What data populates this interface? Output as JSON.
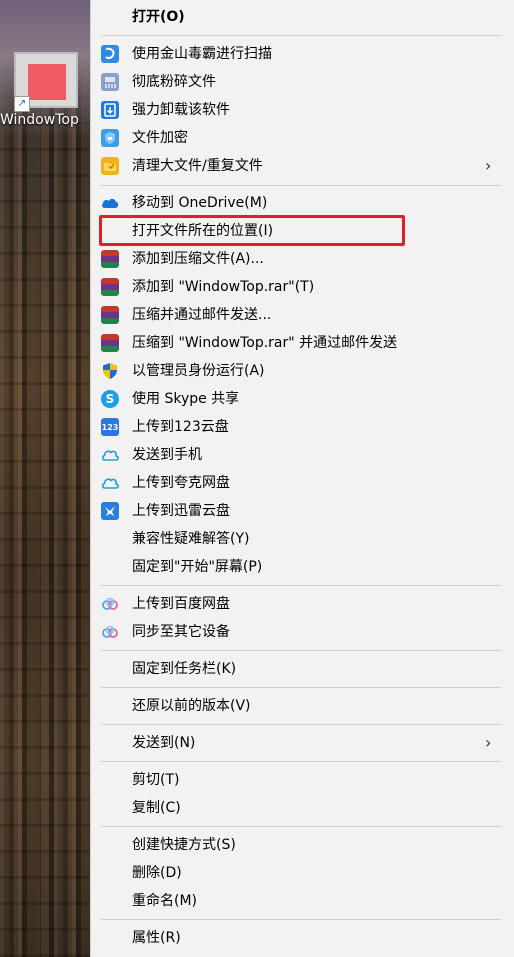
{
  "desktop": {
    "shortcut_label": "WindowTop"
  },
  "menu": {
    "items": [
      {
        "label": "打开(O)",
        "icon": "none",
        "bold": true
      },
      {
        "label": "使用金山毒霸进行扫描",
        "icon": "kingsoft-shield-icon"
      },
      {
        "label": "彻底粉碎文件",
        "icon": "shredder-icon"
      },
      {
        "label": "强力卸载该软件",
        "icon": "uninstall-icon"
      },
      {
        "label": "文件加密",
        "icon": "lock-shield-icon"
      },
      {
        "label": "清理大文件/重复文件",
        "icon": "folder-clean-icon"
      },
      {
        "label": "移动到 OneDrive(M)",
        "icon": "onedrive-cloud-icon"
      },
      {
        "label": "打开文件所在的位置(I)",
        "icon": "none"
      },
      {
        "label": "添加到压缩文件(A)...",
        "icon": "winrar-icon"
      },
      {
        "label": "添加到 \"WindowTop.rar\"(T)",
        "icon": "winrar-icon"
      },
      {
        "label": "压缩并通过邮件发送...",
        "icon": "winrar-icon"
      },
      {
        "label": "压缩到 \"WindowTop.rar\" 并通过邮件发送",
        "icon": "winrar-icon"
      },
      {
        "label": "以管理员身份运行(A)",
        "icon": "uac-shield-icon"
      },
      {
        "label": "使用 Skype 共享",
        "icon": "skype-icon"
      },
      {
        "label": "上传到123云盘",
        "icon": "cloud-123-icon"
      },
      {
        "label": "发送到手机",
        "icon": "cloud-phone-icon"
      },
      {
        "label": "上传到夸克网盘",
        "icon": "quark-cloud-icon"
      },
      {
        "label": "上传到迅雷云盘",
        "icon": "xunlei-bird-icon"
      },
      {
        "label": "兼容性疑难解答(Y)",
        "icon": "none"
      },
      {
        "label": "固定到\"开始\"屏幕(P)",
        "icon": "none"
      },
      {
        "label": "上传到百度网盘",
        "icon": "baidu-cloud-icon"
      },
      {
        "label": "同步至其它设备",
        "icon": "baidu-cloud-icon"
      },
      {
        "label": "固定到任务栏(K)",
        "icon": "none"
      },
      {
        "label": "还原以前的版本(V)",
        "icon": "none"
      },
      {
        "label": "发送到(N)",
        "icon": "none"
      },
      {
        "label": "剪切(T)",
        "icon": "none"
      },
      {
        "label": "复制(C)",
        "icon": "none"
      },
      {
        "label": "创建快捷方式(S)",
        "icon": "none"
      },
      {
        "label": "删除(D)",
        "icon": "none"
      },
      {
        "label": "重命名(M)",
        "icon": "none"
      },
      {
        "label": "属性(R)",
        "icon": "none"
      }
    ],
    "submenu_arrow": "›"
  },
  "colors": {
    "menu_bg": "#f2f2f2",
    "highlight_border": "#e32020",
    "separator": "#cfcfcf"
  }
}
